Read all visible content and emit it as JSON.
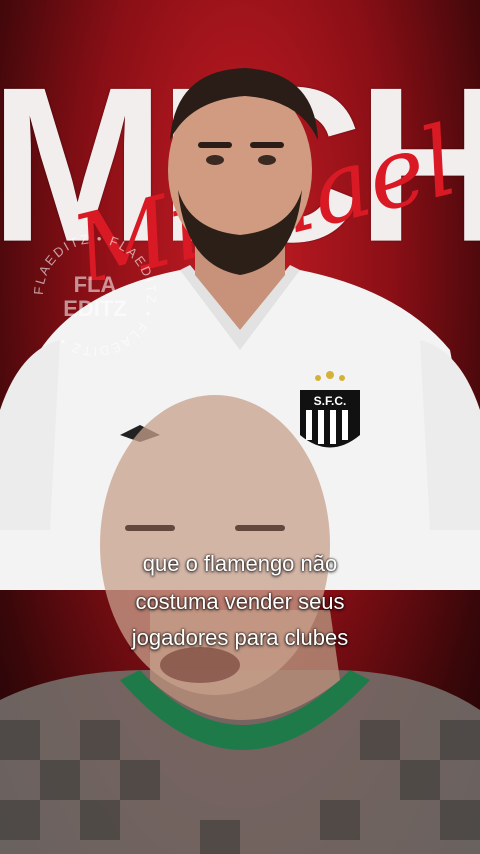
{
  "background_text": {
    "big_letters": "MICHAEL",
    "script_name": "Michael"
  },
  "watermark": {
    "ring_text": "FLAEDITZ • FLAEDITZ • FLAEDITZ •",
    "center_line1": "FLA",
    "center_line2": "EDITZ"
  },
  "jersey_crest": {
    "text": "S.F.C."
  },
  "captions": [
    "que o flamengo não",
    "costuma vender seus",
    "jogadores para clubes"
  ],
  "colors": {
    "background_red": "#c81c24",
    "script_red": "#d91a25",
    "jersey_white": "#f3f3f3",
    "collar_green": "#1f7a4a"
  }
}
